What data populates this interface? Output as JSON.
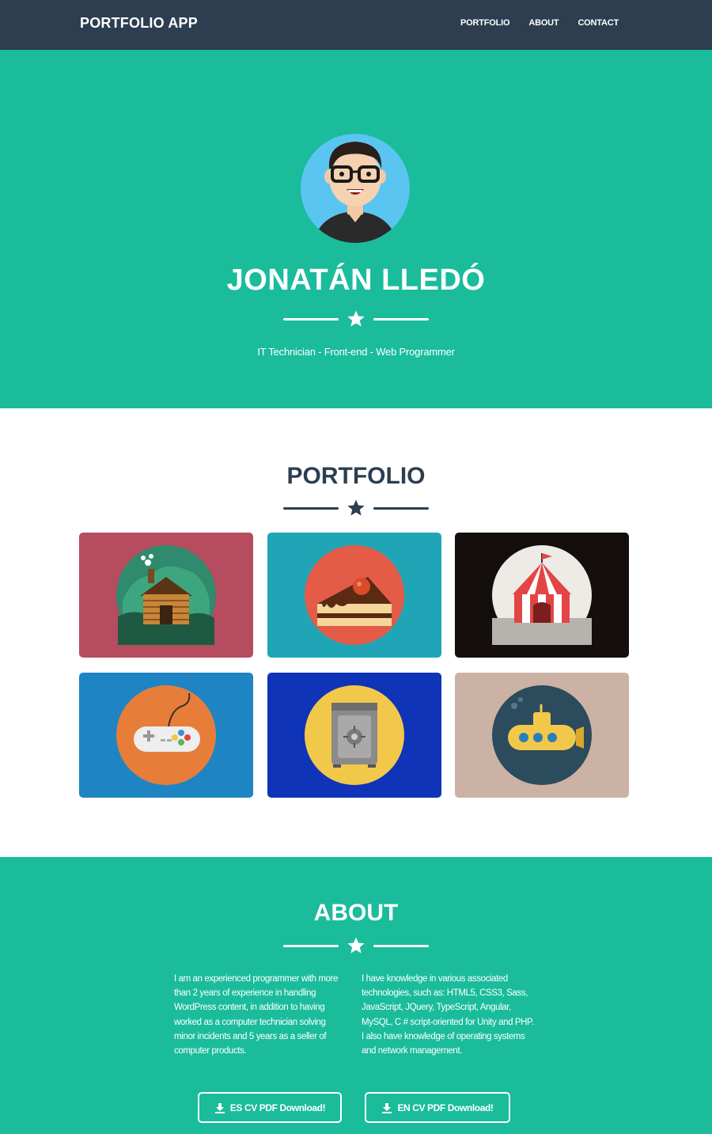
{
  "navbar": {
    "brand": "PORTFOLIO APP",
    "links": [
      "PORTFOLIO",
      "ABOUT",
      "CONTACT"
    ]
  },
  "hero": {
    "name": "JONATÁN LLEDÓ",
    "subtitle": "IT Technician - Front-end - Web Programmer",
    "divider_icon": "star-icon"
  },
  "portfolio": {
    "title": "PORTFOLIO",
    "items": [
      {
        "icon": "cabin-icon",
        "bg": "#b54d5e"
      },
      {
        "icon": "cake-icon",
        "bg": "#1fa5b5"
      },
      {
        "icon": "circus-tent-icon",
        "bg": "#140e0d"
      },
      {
        "icon": "game-controller-icon",
        "bg": "#1e84c4"
      },
      {
        "icon": "safe-icon",
        "bg": "#0f34b8"
      },
      {
        "icon": "submarine-icon",
        "bg": "#cbb2a5"
      }
    ]
  },
  "about": {
    "title": "ABOUT",
    "left_text": "I am an experienced programmer with more than 2 years of experience in handling WordPress content, in addition to having worked as a computer technician solving minor incidents and 5 years as a seller of computer products.",
    "right_text": "I have knowledge in various associated technologies, such as: HTML5, CSS3, Sass, JavaScript, JQuery, TypeScript, Angular, MySQL, C # script-oriented for Unity and PHP. I also have knowledge of operating systems and network management.",
    "buttons": [
      "ES CV PDF Download!",
      "EN CV PDF Download!"
    ],
    "button_icon": "download-icon"
  },
  "colors": {
    "navbar": "#2c3e50",
    "primary": "#1abc9c",
    "dark_text": "#2c3e50"
  }
}
